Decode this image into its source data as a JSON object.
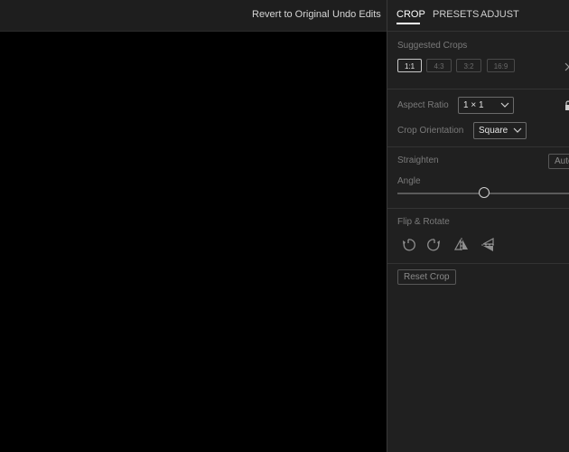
{
  "topbar": {
    "revert_label": "Revert to Original",
    "undo_label": "Undo Edits"
  },
  "tabs": [
    {
      "label": "CROP",
      "active": true
    },
    {
      "label": "PRESETS",
      "active": false
    },
    {
      "label": "ADJUST",
      "active": false
    }
  ],
  "crop": {
    "suggested_label": "Suggested Crops",
    "suggested": [
      "1:1",
      "4:3",
      "3:2",
      "16:9"
    ],
    "suggested_selected": "1:1",
    "aspect_label": "Aspect Ratio",
    "aspect_value": "1 × 1",
    "orientation_label": "Crop Orientation",
    "orientation_value": "Square",
    "straighten_label": "Straighten",
    "auto_label": "Auto",
    "angle_label": "Angle",
    "angle_level": 0.5,
    "flip_label": "Flip & Rotate",
    "flip_icons": [
      "rotate-left-icon",
      "rotate-right-icon",
      "flip-horizontal-icon",
      "flip-vertical-icon"
    ],
    "reset_label": "Reset Crop"
  },
  "colors": {
    "background": "#000000",
    "panel": "#202020",
    "text": "#c8c8c8",
    "muted": "#7a7a7a",
    "active_tab_underline": "#ffffff"
  }
}
